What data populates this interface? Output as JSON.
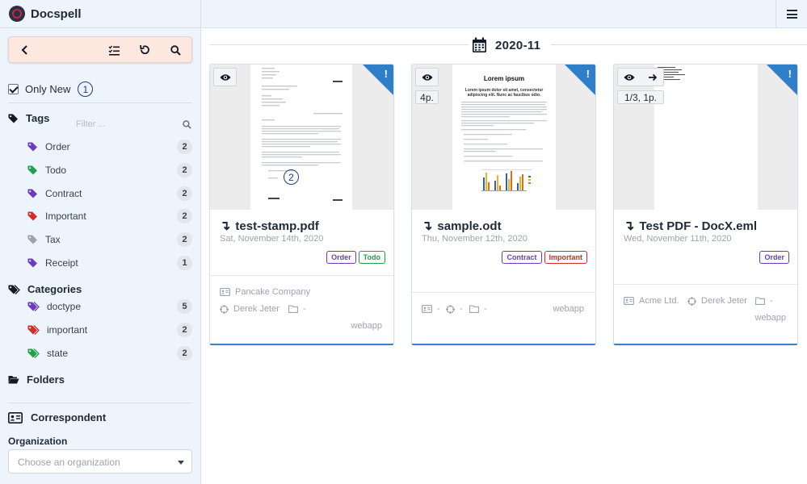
{
  "app": {
    "name": "Docspell"
  },
  "sidebar": {
    "only_new_label": "Only New",
    "only_new_marker": "1",
    "tags_title": "Tags",
    "filter_placeholder": "Filter ...",
    "tags": [
      {
        "name": "Order",
        "count": "2",
        "color": "#6d3bbf"
      },
      {
        "name": "Todo",
        "count": "2",
        "color": "#22a04b"
      },
      {
        "name": "Contract",
        "count": "2",
        "color": "#6d3bbf"
      },
      {
        "name": "Important",
        "count": "2",
        "color": "#d42b2b"
      },
      {
        "name": "Tax",
        "count": "2",
        "color": "#9ca3af"
      },
      {
        "name": "Receipt",
        "count": "1",
        "color": "#6d3bbf"
      }
    ],
    "categories_title": "Categories",
    "categories": [
      {
        "name": "doctype",
        "count": "5",
        "color": "#6d3bbf"
      },
      {
        "name": "important",
        "count": "2",
        "color": "#d42b2b"
      },
      {
        "name": "state",
        "count": "2",
        "color": "#22a04b"
      }
    ],
    "folders_title": "Folders",
    "correspondent_title": "Correspondent",
    "organization_label": "Organization",
    "organization_placeholder": "Choose an organization"
  },
  "main": {
    "month": "2020-11",
    "cards": [
      {
        "title": "test-stamp.pdf",
        "date": "Sat, November 14th, 2020",
        "labels": [
          {
            "text": "Order",
            "color": "#6d3bbf"
          },
          {
            "text": "Todo",
            "color": "#22a04b"
          }
        ],
        "organization": "Pancake Company",
        "person": "Derek Jeter",
        "folder": "-",
        "source": "webapp",
        "preview_marker": "2",
        "pages_badge": ""
      },
      {
        "title": "sample.odt",
        "date": "Thu, November 12th, 2020",
        "labels": [
          {
            "text": "Contract",
            "color": "#6d3bbf"
          },
          {
            "text": "Important",
            "color": "#d42b2b"
          }
        ],
        "organization": "-",
        "person": "-",
        "folder": "-",
        "source": "webapp",
        "pages_badge": "4p.",
        "preview_heading": "Lorem ipsum",
        "preview_subheading": "Lorem ipsum dolor sit amet, consectetur adipiscing elit. Nunc ac faucibus odio."
      },
      {
        "title": "Test PDF - DocX.eml",
        "date": "Wed, November 11th, 2020",
        "labels": [
          {
            "text": "Order",
            "color": "#6d3bbf"
          }
        ],
        "organization": "Acme Ltd.",
        "person": "Derek Jeter",
        "folder": "-",
        "source": "webapp",
        "pages_badge": "1/3, 1p."
      }
    ]
  },
  "icons": {
    "toolbar": [
      "chevron-left-icon",
      "checklist-icon",
      "undo-icon",
      "search-icon"
    ],
    "new_item_marker": "!"
  }
}
